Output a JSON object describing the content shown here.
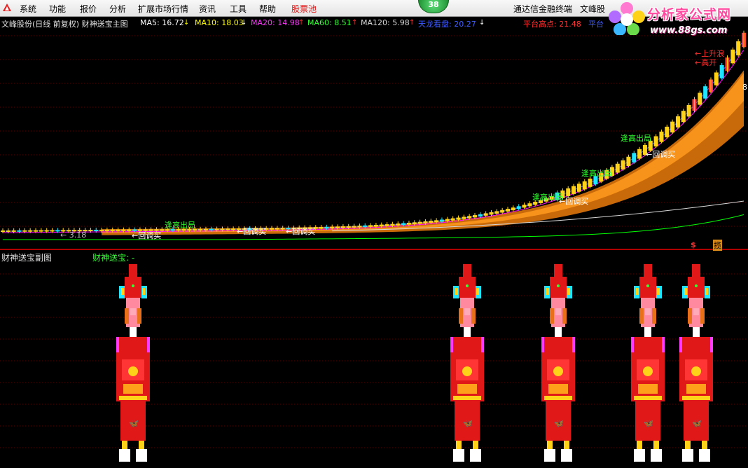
{
  "menu": {
    "items": [
      "系统",
      "功能",
      "报价",
      "分析",
      "扩展市场行情",
      "资讯",
      "工具",
      "帮助"
    ],
    "stock_pool": "股票池",
    "badge_count": "38",
    "terminal": "通达信金融终端",
    "stock_short": "文峰股"
  },
  "watermark": {
    "brand": "分析家公式网",
    "url": "www.88gs.com"
  },
  "main_header": {
    "title": "文峰股份(日线 前复权) 财神送宝主图",
    "ma5": "MA5: 16.72",
    "ma10": "MA10: 18.03",
    "ma20": "MA20: 14.98",
    "ma60": "MA60: 8.51",
    "ma120": "MA120: 5.98",
    "dragon": "天龙看盘: 20.27",
    "platform_high": "平台高点: 21.48",
    "platform": "平台"
  },
  "main_labels": {
    "low_price": "← 3.18",
    "pullback": "←回调买",
    "escape_high": "逢高出局",
    "fall": "←上升浪",
    "high_open": "←高开",
    "side_mark": "8",
    "footer_icon": "$",
    "footer_flag": "揽"
  },
  "sub_header": {
    "title": "财神送宝副图",
    "indicator": "财神送宝: -"
  },
  "colors": {
    "up": "#ff3b3b",
    "down": "#1ee6ff",
    "ma5": "#ffffff",
    "ma10": "#ffff00",
    "ma20": "#ff00ff",
    "ma60": "#00ff00",
    "ma120": "#d8d8d8",
    "dragon": "#3f5cff",
    "band_outer": "#c96a0a",
    "band_inner": "#ff9a1e"
  },
  "chart_data": {
    "type": "candlestick",
    "signals_sub": [
      {
        "x": 0.177
      },
      {
        "x": 0.624
      },
      {
        "x": 0.745
      },
      {
        "x": 0.865
      },
      {
        "x": 0.93
      }
    ]
  }
}
